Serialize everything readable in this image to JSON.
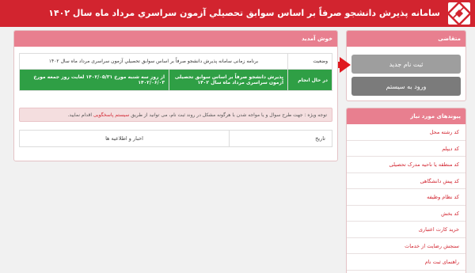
{
  "header": {
    "title": "سامانه پذيرش دانشجو صرفاً بر اساس سوابق تحصيلي آزمون سراسري مرداد ماه سال ۱۴۰۲"
  },
  "applicant": {
    "heading": "متقاضی",
    "register_label": "ثبت نام جدید",
    "login_label": "ورود به سیستم"
  },
  "links": {
    "heading": "پیوندهای مورد نیاز",
    "items": [
      "کد رشته محل",
      "کد دیپلم",
      "کد منطقه یا ناحیه مدرک تحصیلی",
      "کد پیش دانشگاهی",
      "کد نظام وظیفه",
      "کد بخش",
      "خرید کارت اعتباری",
      "سنجش رضایت از خدمات",
      "راهنمای ثبت نام"
    ]
  },
  "welcome": {
    "heading": "خوش آمدید",
    "table": {
      "col_status": "وضعیت",
      "col_title": "برنامه زمانی سامانه پذیرش دانشجو صرفاً بر اساس سوابق تحصيلي آزمون سراسری مرداد ماه سال ۱۴۰۲",
      "row_status": "در حال انجام",
      "row_desc": "پذیرش دانشجو صرفاً بر اساس سوابق تحصیلی آزمون سراسری مرداد ماه سال ۱۴۰۲",
      "row_dates": "از روز سه شنبه مورخ ۱۴۰۲/۰۵/۳۱ لغایت روز جمعه مورخ ۱۴۰۲/۰۶/۰۳"
    },
    "notice_prefix": "توجه ویژه : جهت طرح سوال و یا مواجه شدن با هرگونه مشکل در روند ثبت نام، می توانید از طریق ",
    "notice_link": "سیستم پاسخگویی",
    "notice_suffix": " اقدام نمایید.",
    "news": {
      "col_date": "تاریخ",
      "col_news": "اخبار و اطلاعیه ها"
    }
  },
  "colors": {
    "brand": "#d2242f",
    "panel_header": "#e87f8f",
    "status_green": "#2f9f45"
  },
  "icons": {
    "logo": "university-logo-icon",
    "arrow": "red-arrow-right-icon"
  }
}
